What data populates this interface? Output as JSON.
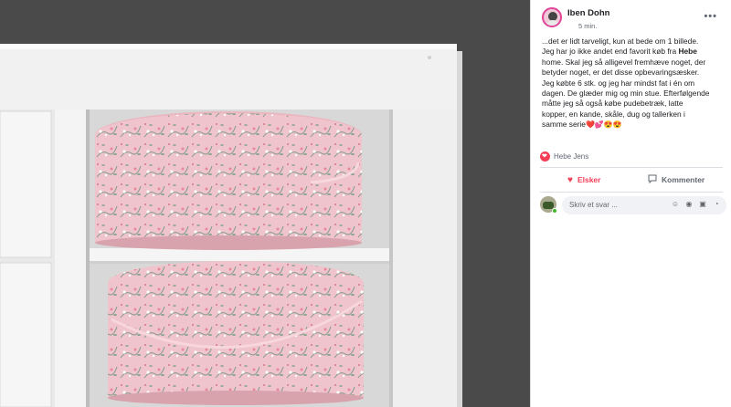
{
  "post": {
    "author": "Iben Dohn",
    "timestamp": "5 min.",
    "more_label": "•••",
    "text_lines": [
      "...det er lidt tarveligt, kun at bede om 1 billede.",
      "Jeg har jo ikke andet end favorit køb fra ",
      "home. Skal jeg så alligevel fremhæve noget, der",
      "betyder noget, er det disse opbevaringsæsker.",
      "Jeg købte 6 stk. og jeg har mindst fat i én om",
      "dagen. De glæder mig og min stue. Efterfølgende",
      "måtte jeg så også købe pudebetræk, latte",
      "kopper, en kande, skåle, dug og tallerken i",
      "samme serie"
    ],
    "brand_bold": "Hebe",
    "emojis": "❤️💕😍😍"
  },
  "reactions": {
    "names": "Hebe Jens"
  },
  "actions": {
    "like_label": "Elsker",
    "comment_label": "Kommenter"
  },
  "comment": {
    "placeholder": "Skriv et svar ..."
  },
  "icons": {
    "like": "heart-icon",
    "comment": "comment-bubble-icon",
    "reaction": "love-reaction-icon",
    "more": "more-options-icon"
  },
  "colors": {
    "love_red": "#f33e58",
    "panel_bg": "#ffffff",
    "text": "#1c1e21",
    "muted": "#606770",
    "box_pink": "#f2c6cf",
    "shelf_white": "#ececec"
  }
}
